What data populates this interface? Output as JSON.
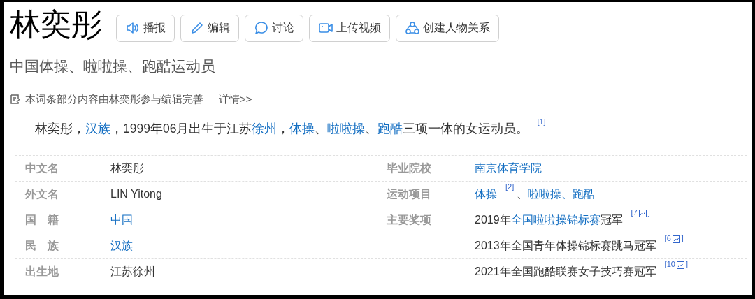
{
  "title": "林奕彤",
  "actions": [
    {
      "label": "播报"
    },
    {
      "label": "编辑"
    },
    {
      "label": "讨论"
    },
    {
      "label": "上传视频"
    },
    {
      "label": "创建人物关系"
    }
  ],
  "subtitle": "中国体操、啦啦操、跑酷运动员",
  "notice": {
    "text": "本词条部分内容由林奕彤参与编辑完善",
    "link": "详情>>"
  },
  "summary": [
    {
      "kind": "text",
      "text": "林奕彤，"
    },
    {
      "kind": "link",
      "text": "汉族"
    },
    {
      "kind": "text",
      "text": "，1999年06月出生于江苏"
    },
    {
      "kind": "link",
      "text": "徐州"
    },
    {
      "kind": "text",
      "text": "，"
    },
    {
      "kind": "link",
      "text": "体操"
    },
    {
      "kind": "text",
      "text": "、"
    },
    {
      "kind": "link",
      "text": "啦啦操"
    },
    {
      "kind": "text",
      "text": "、"
    },
    {
      "kind": "link",
      "text": "跑酷"
    },
    {
      "kind": "text",
      "text": "三项一体的女运动员。"
    },
    {
      "kind": "ref",
      "text": "[1]"
    }
  ],
  "infobox": [
    {
      "left": {
        "label": "中文名",
        "value": [
          {
            "kind": "text",
            "text": "林奕彤"
          }
        ]
      },
      "right": {
        "label": "毕业院校",
        "value": [
          {
            "kind": "link",
            "text": "南京体育学院"
          }
        ]
      }
    },
    {
      "left": {
        "label": "外文名",
        "value": [
          {
            "kind": "text",
            "text": "LIN Yitong"
          }
        ]
      },
      "right": {
        "label": "运动项目",
        "value": [
          {
            "kind": "link",
            "text": "体操"
          },
          {
            "kind": "ref",
            "text": "[2]"
          },
          {
            "kind": "text",
            "text": "、"
          },
          {
            "kind": "link",
            "text": "啦啦操"
          },
          {
            "kind": "link",
            "text": "、跑酷"
          }
        ]
      }
    },
    {
      "left": {
        "label": "国　籍",
        "value": [
          {
            "kind": "link",
            "text": "中国"
          }
        ]
      },
      "right": {
        "label": "主要奖项",
        "value": [
          {
            "kind": "text",
            "text": "2019年"
          },
          {
            "kind": "link",
            "text": "全国啦啦操锦标赛"
          },
          {
            "kind": "text",
            "text": "冠军"
          },
          {
            "kind": "ref",
            "text": "[7",
            "after_icon": "]"
          }
        ]
      }
    },
    {
      "left": {
        "label": "民　族",
        "value": [
          {
            "kind": "link",
            "text": "汉族"
          }
        ]
      },
      "right": {
        "value": [
          {
            "kind": "text",
            "text": "2013年全国青年体操锦标赛跳马冠军"
          },
          {
            "kind": "ref",
            "text": "[6",
            "after_icon": "]"
          }
        ]
      }
    },
    {
      "left": {
        "label": "出生地",
        "value": [
          {
            "kind": "text",
            "text": "江苏徐州"
          }
        ]
      },
      "right": {
        "value": [
          {
            "kind": "text",
            "text": "2021年全国跑酷联赛女子技巧赛冠军"
          },
          {
            "kind": "ref",
            "text": "[10",
            "after_icon": "]"
          }
        ]
      }
    }
  ]
}
